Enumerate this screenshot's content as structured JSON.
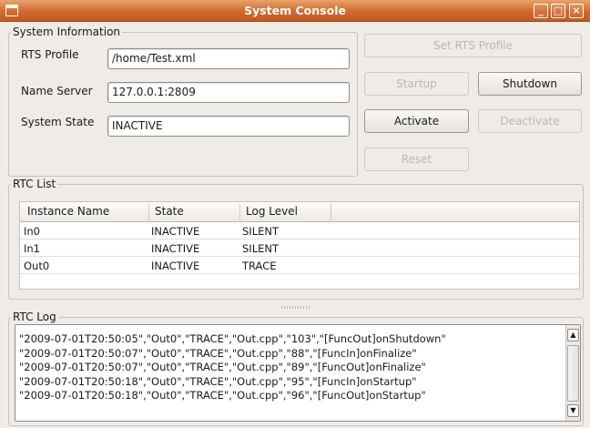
{
  "window": {
    "title": "System Console"
  },
  "system_info": {
    "legend": "System Information",
    "rts_profile_label": "RTS Profile",
    "rts_profile_value": "/home/Test.xml",
    "name_server_label": "Name Server",
    "name_server_value": "127.0.0.1:2809",
    "system_state_label": "System State",
    "system_state_value": "INACTIVE"
  },
  "buttons": {
    "set_rts_profile": "Set RTS Profile",
    "startup": "Startup",
    "shutdown": "Shutdown",
    "activate": "Activate",
    "deactivate": "Deactivate",
    "reset": "Reset"
  },
  "rtc_list": {
    "legend": "RTC List",
    "columns": [
      "Instance Name",
      "State",
      "Log Level"
    ],
    "rows": [
      {
        "instance": "In0",
        "state": "INACTIVE",
        "log_level": "SILENT"
      },
      {
        "instance": "In1",
        "state": "INACTIVE",
        "log_level": "SILENT"
      },
      {
        "instance": "Out0",
        "state": "INACTIVE",
        "log_level": "TRACE"
      }
    ]
  },
  "rtc_log": {
    "legend": "RTC Log",
    "lines": [
      "\"2009-07-01T20:50:05\",\"Out0\",\"TRACE\",\"Out.cpp\",\"103\",\"[FuncOut]onShutdown\"",
      "\"2009-07-01T20:50:07\",\"Out0\",\"TRACE\",\"Out.cpp\",\"88\",\"[FuncIn]onFinalize\"",
      "\"2009-07-01T20:50:07\",\"Out0\",\"TRACE\",\"Out.cpp\",\"89\",\"[FuncOut]onFinalize\"",
      "\"2009-07-01T20:50:18\",\"Out0\",\"TRACE\",\"Out.cpp\",\"95\",\"[FuncIn]onStartup\"",
      "\"2009-07-01T20:50:18\",\"Out0\",\"TRACE\",\"Out.cpp\",\"96\",\"[FuncOut]onStartup\""
    ]
  },
  "icons": {
    "window_menu": "window-menu-icon",
    "minimize": "minimize-icon",
    "maximize": "maximize-icon",
    "close": "close-icon",
    "scroll_up": "arrow-up-icon",
    "scroll_down": "arrow-down-icon"
  }
}
